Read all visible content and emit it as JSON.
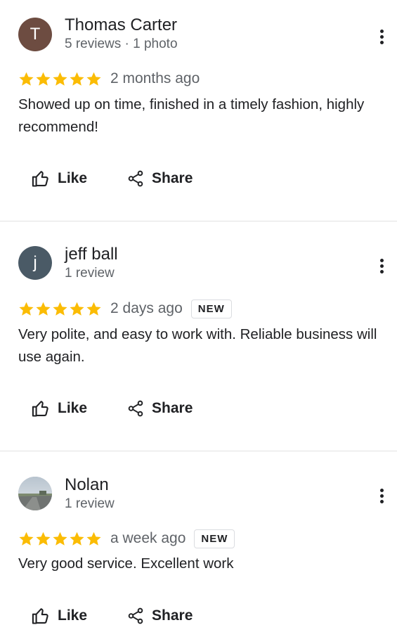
{
  "colors": {
    "star": "#fbbc04",
    "avatar_t": "#6d4c41",
    "avatar_j": "#4a5a66"
  },
  "reviews": [
    {
      "avatar_letter": "T",
      "name": "Thomas Carter",
      "meta": "5 reviews · 1 photo",
      "rating": 5,
      "time": "2 months ago",
      "badge": "",
      "text": "Showed up on time, finished in a timely fashion, highly recommend!",
      "like_label": "Like",
      "share_label": "Share"
    },
    {
      "avatar_letter": "j",
      "name": "jeff ball",
      "meta": "1 review",
      "rating": 5,
      "time": "2 days ago",
      "badge": "NEW",
      "text": "Very polite, and easy to work with.  Reliable business will use again.",
      "like_label": "Like",
      "share_label": "Share"
    },
    {
      "avatar_letter": "",
      "name": "Nolan",
      "meta": "1 review",
      "rating": 5,
      "time": "a week ago",
      "badge": "NEW",
      "text": "Very good service. Excellent work",
      "like_label": "Like",
      "share_label": "Share"
    }
  ]
}
